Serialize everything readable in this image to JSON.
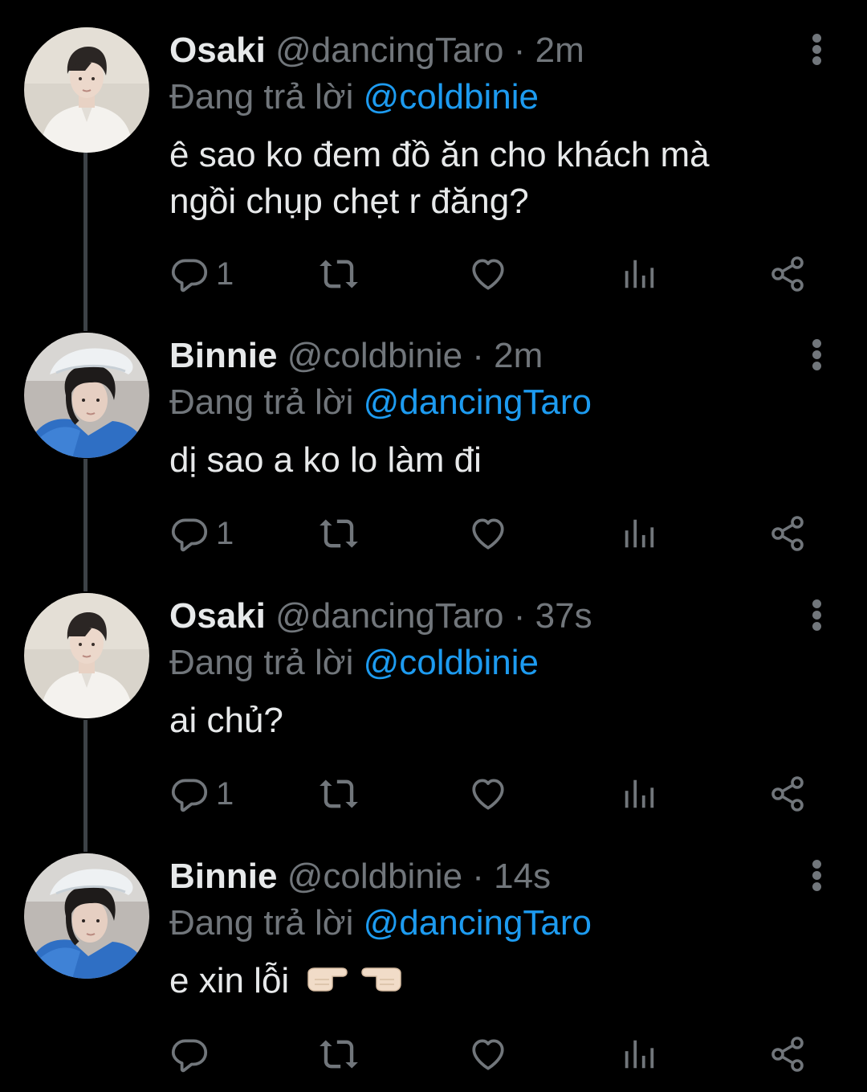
{
  "tweets": [
    {
      "name": "Osaki",
      "handle": "@dancingTaro",
      "dot": "·",
      "time": "2m",
      "reply_prefix": "Đang trả lời",
      "reply_to": "@coldbinie",
      "text_line1": "ê sao ko đem đồ ăn cho khách mà",
      "text_line2": "ngồi chụp chẹt r đăng?",
      "reply_count": "1"
    },
    {
      "name": "Binnie",
      "handle": "@coldbinie",
      "dot": "·",
      "time": "2m",
      "reply_prefix": "Đang trả lời",
      "reply_to": "@dancingTaro",
      "text_line1": "dị sao a ko lo làm đi",
      "reply_count": "1"
    },
    {
      "name": "Osaki",
      "handle": "@dancingTaro",
      "dot": "·",
      "time": "37s",
      "reply_prefix": "Đang trả lời",
      "reply_to": "@coldbinie",
      "text_line1": "ai chủ?",
      "reply_count": "1"
    },
    {
      "name": "Binnie",
      "handle": "@coldbinie",
      "dot": "·",
      "time": "14s",
      "reply_prefix": "Đang trả lời",
      "reply_to": "@dancingTaro",
      "text_line1": "e xin lỗi",
      "reply_count": ""
    }
  ],
  "icons": {
    "reply": "reply-icon",
    "retweet": "retweet-icon",
    "like": "heart-icon",
    "views": "views-icon",
    "share": "share-icon",
    "more": "more-vertical-icon"
  },
  "colors": {
    "background": "#000000",
    "text": "#e7e9ea",
    "secondary": "#71767b",
    "accent": "#1d9bf0",
    "thread_line": "#3d4247"
  }
}
